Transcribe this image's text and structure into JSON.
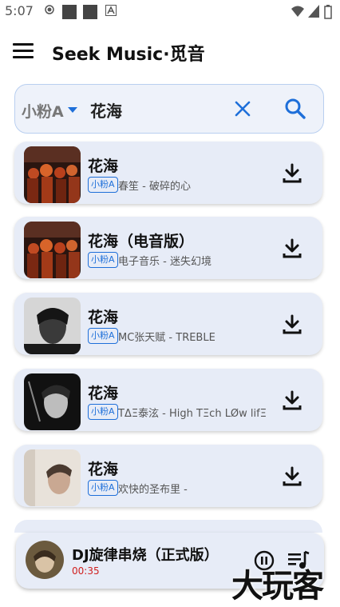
{
  "status_bar": {
    "time": "5:07"
  },
  "app": {
    "title": "Seek Music·觅音"
  },
  "search": {
    "source": "小粉A",
    "query": "花海"
  },
  "results": [
    {
      "title": "花海",
      "badge": "小粉A",
      "subtitle": "春笙 - 破碎的心"
    },
    {
      "title": "花海（电音版）",
      "badge": "小粉A",
      "subtitle": "电子音乐 - 迷失幻境"
    },
    {
      "title": "花海",
      "badge": "小粉A",
      "subtitle": "MC张天赋 - TREBLE"
    },
    {
      "title": "花海",
      "badge": "小粉A",
      "subtitle": "TΔΞ泰泫 - High TΞch LØw lifΞ"
    },
    {
      "title": "花海",
      "badge": "小粉A",
      "subtitle": "欢快的圣布里 -"
    }
  ],
  "player": {
    "title": "DJ旋律串烧（正式版）",
    "time": "00:35"
  },
  "watermark": "大玩客",
  "colors": {
    "accent": "#1e6fd9",
    "card_bg": "#e7ecf7",
    "time_red": "#d0201f"
  }
}
